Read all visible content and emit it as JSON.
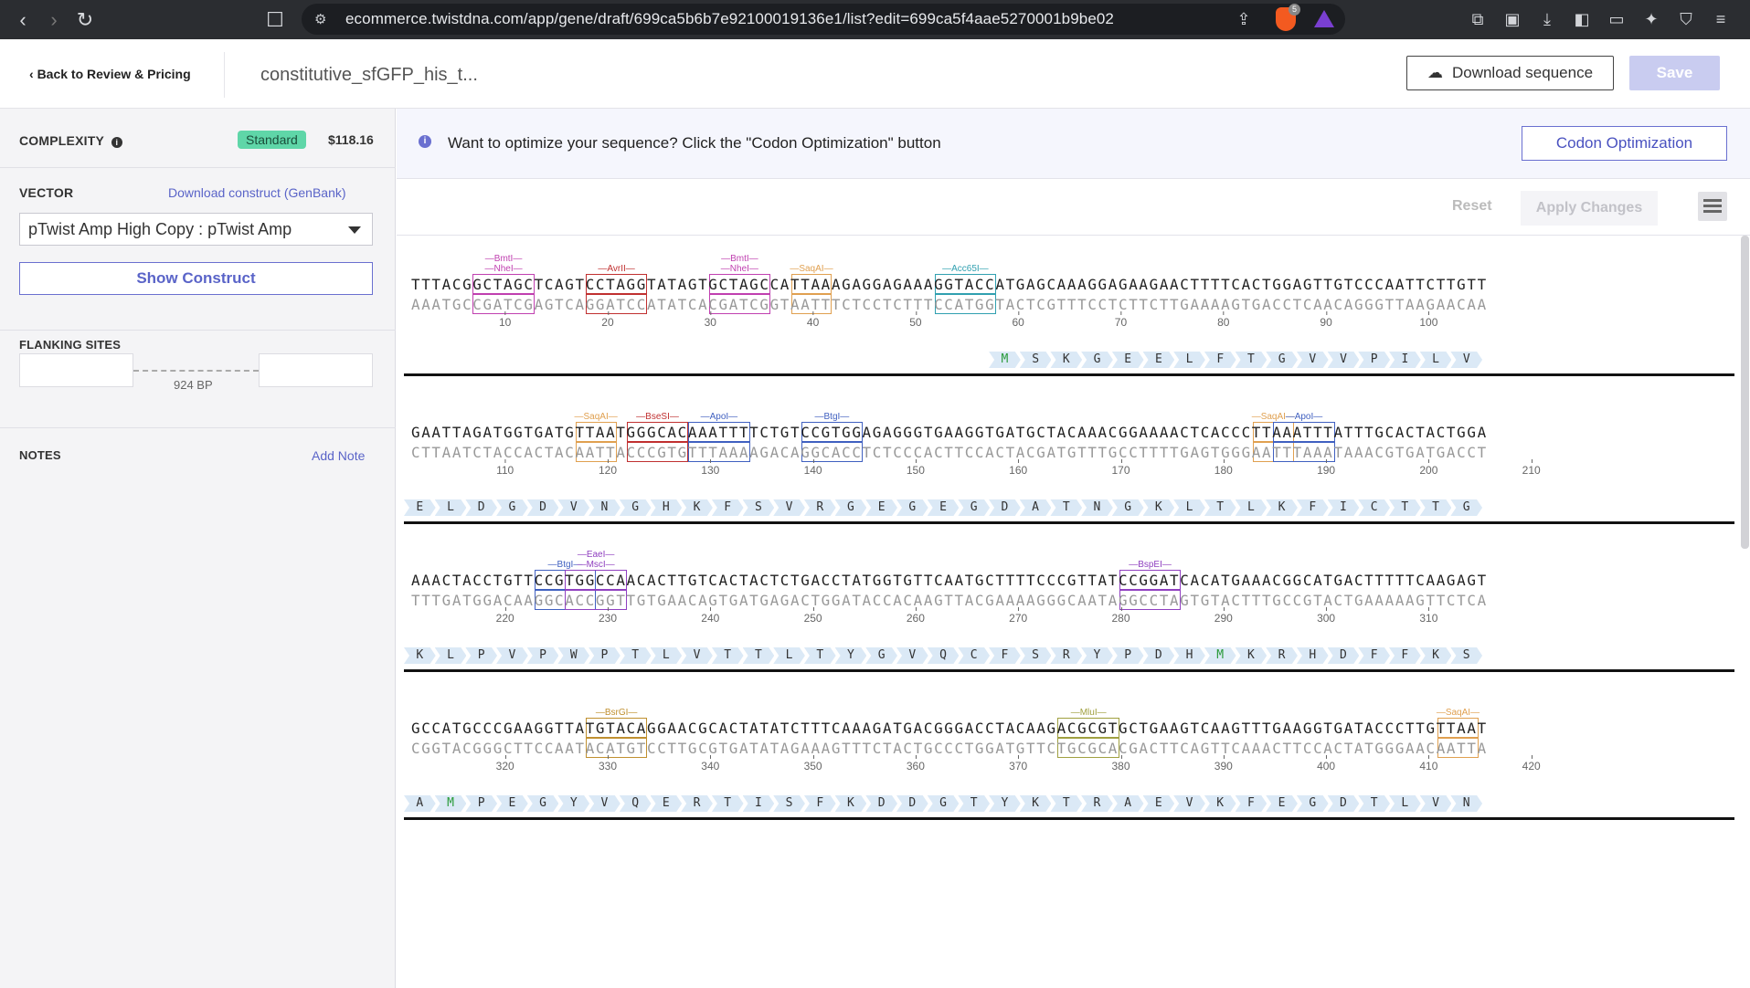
{
  "browser": {
    "url": "ecommerce.twistdna.com/app/gene/draft/699ca5b6b7e92100019136e1/list?edit=699ca5f4aae5270001b9be02",
    "brave_badge": "5"
  },
  "header": {
    "back_label": "Back to Review & Pricing",
    "gene_title": "constitutive_sfGFP_his_t...",
    "download_label": "Download sequence",
    "save_label": "Save"
  },
  "sidebar": {
    "complexity_label": "COMPLEXITY",
    "complexity_badge": "Standard",
    "price": "$118.16",
    "vector_label": "VECTOR",
    "download_construct_label": "Download construct (GenBank)",
    "vector_value": "pTwist Amp High Copy : pTwist Amp",
    "show_construct_label": "Show Construct",
    "flanking_label": "FLANKING SITES",
    "flanking_bp": "924 BP",
    "notes_label": "NOTES",
    "add_note_label": "Add Note"
  },
  "main": {
    "info_text": "Want to optimize your sequence? Click the \"Codon Optimization\" button",
    "codon_button": "Codon Optimization",
    "reset_label": "Reset",
    "apply_label": "Apply Changes"
  },
  "sequence": {
    "rows": [
      {
        "fwd": "TTTACGGCTAGCTCAGTCCTAGGTATAGTGCTAGCCATTAAAGAGGAGAAAGGTACCATGAGCAAAGGAGAAGAACTTTTCACTGGAGTTGTCCCAATTCTTGTT",
        "rev": "AAATGCCGATCGAGTCAGGATCCATATCACGATCGGTAATTTCTCCTCTTTCCATGGTACTCGTTTCCTCTTCTTGAAAAGTGACCTCAACAGGGTTAAGAACAA",
        "ticks": [
          "10",
          "20",
          "30",
          "40",
          "50",
          "60",
          "70",
          "80",
          "90",
          "100"
        ],
        "protein": [
          "M",
          "S",
          "K",
          "G",
          "E",
          "E",
          "L",
          "F",
          "T",
          "G",
          "V",
          "V",
          "P",
          "I",
          "L",
          "V"
        ],
        "protein_start": 57,
        "enzymes": [
          {
            "names": [
              "BmtI",
              "NheI"
            ],
            "start": 6,
            "len": 6,
            "color": "#c040b0"
          },
          {
            "names": [
              "AvrII"
            ],
            "start": 17,
            "len": 6,
            "color": "#c03030"
          },
          {
            "names": [
              "BmtI",
              "NheI"
            ],
            "start": 29,
            "len": 6,
            "color": "#c040b0"
          },
          {
            "names": [
              "SaqAI"
            ],
            "start": 37,
            "len": 4,
            "color": "#e0a050"
          },
          {
            "names": [
              "Acc65I"
            ],
            "start": 51,
            "len": 6,
            "color": "#30a0b0"
          }
        ]
      },
      {
        "fwd": "GAATTAGATGGTGATGTTAATGGGCACAAATTTTCTGTCCGTGGAGAGGGTGAAGGTGATGCTACAAACGGAAAACTCACCCTTAAATTTATTTGCACTACTGGA",
        "rev": "CTTAATCTACCACTACAATTACCCGTGTTTAAAAGACAGGCACCTCTCCCACTTCCACTACGATGTTTGCCTTTTGAGTGGGAATTTAAATAAACGTGATGACCT",
        "ticks": [
          "110",
          "120",
          "130",
          "140",
          "150",
          "160",
          "170",
          "180",
          "190",
          "200",
          "210"
        ],
        "protein": [
          "E",
          "L",
          "D",
          "G",
          "D",
          "V",
          "N",
          "G",
          "H",
          "K",
          "F",
          "S",
          "V",
          "R",
          "G",
          "E",
          "G",
          "E",
          "G",
          "D",
          "A",
          "T",
          "N",
          "G",
          "K",
          "L",
          "T",
          "L",
          "K",
          "F",
          "I",
          "C",
          "T",
          "T",
          "G"
        ],
        "protein_start": 0,
        "enzymes": [
          {
            "names": [
              "SaqAI"
            ],
            "start": 16,
            "len": 4,
            "color": "#e0a050"
          },
          {
            "names": [
              "BseSI"
            ],
            "start": 21,
            "len": 6,
            "color": "#c03030"
          },
          {
            "names": [
              "ApoI"
            ],
            "start": 27,
            "len": 6,
            "color": "#4060c0"
          },
          {
            "names": [
              "BtgI"
            ],
            "start": 38,
            "len": 6,
            "color": "#4060c0"
          },
          {
            "names": [
              "SaqAI"
            ],
            "start": 82,
            "len": 4,
            "color": "#e0a050"
          },
          {
            "names": [
              "ApoI"
            ],
            "start": 84,
            "len": 6,
            "color": "#4060c0"
          }
        ]
      },
      {
        "fwd": "AAACTACCTGTTCCGTGGCCAACACTTGTCACTACTCTGACCTATGGTGTTCAATGCTTTTCCCGTTATCCGGATCACATGAAACGGCATGACTTTTTCAAGAGT",
        "rev": "TTTGATGGACAAGGCACCGGTTGTGAACAGTGATGAGACTGGATACCACAAGTTACGAAAAGGGCAATAGGCCTAGTGTACTTTGCCGTACTGAAAAAGTTCTCA",
        "ticks": [
          "220",
          "230",
          "240",
          "250",
          "260",
          "270",
          "280",
          "290",
          "300",
          "310"
        ],
        "protein": [
          "K",
          "L",
          "P",
          "V",
          "P",
          "W",
          "P",
          "T",
          "L",
          "V",
          "T",
          "T",
          "L",
          "T",
          "Y",
          "G",
          "V",
          "Q",
          "C",
          "F",
          "S",
          "R",
          "Y",
          "P",
          "D",
          "H",
          "M",
          "K",
          "R",
          "H",
          "D",
          "F",
          "F",
          "K",
          "S"
        ],
        "protein_start": 0,
        "enzymes": [
          {
            "names": [
              "BtgI"
            ],
            "start": 12,
            "len": 6,
            "color": "#4060c0"
          },
          {
            "names": [
              "EaeI",
              "MscI"
            ],
            "start": 15,
            "len": 6,
            "color": "#9040c0"
          },
          {
            "names": [
              "BspEI"
            ],
            "start": 69,
            "len": 6,
            "color": "#9040c0"
          }
        ]
      },
      {
        "fwd": "GCCATGCCCGAAGGTTATGTACAGGAACGCACTATATCTTTCAAAGATGACGGGACCTACAAGACGCGTGCTGAAGTCAAGTTTGAAGGTGATACCCTTGTTAAT",
        "rev": "CGGTACGGGCTTCCAATACATGTCCTTGCGTGATATAGAAAGTTTCTACTGCCCTGGATGTTCTGCGCACGACTTCAGTTCAAACTTCCACTATGGGAACAATTA",
        "ticks": [
          "320",
          "330",
          "340",
          "350",
          "360",
          "370",
          "380",
          "390",
          "400",
          "410",
          "420"
        ],
        "protein": [
          "A",
          "M",
          "P",
          "E",
          "G",
          "Y",
          "V",
          "Q",
          "E",
          "R",
          "T",
          "I",
          "S",
          "F",
          "K",
          "D",
          "D",
          "G",
          "T",
          "Y",
          "K",
          "T",
          "R",
          "A",
          "E",
          "V",
          "K",
          "F",
          "E",
          "G",
          "D",
          "T",
          "L",
          "V",
          "N"
        ],
        "protein_start": 0,
        "enzymes": [
          {
            "names": [
              "BsrGI"
            ],
            "start": 17,
            "len": 6,
            "color": "#c09030"
          },
          {
            "names": [
              "MluI"
            ],
            "start": 63,
            "len": 6,
            "color": "#a0a040"
          },
          {
            "names": [
              "SaqAI"
            ],
            "start": 100,
            "len": 4,
            "color": "#e0a050"
          }
        ]
      }
    ]
  }
}
